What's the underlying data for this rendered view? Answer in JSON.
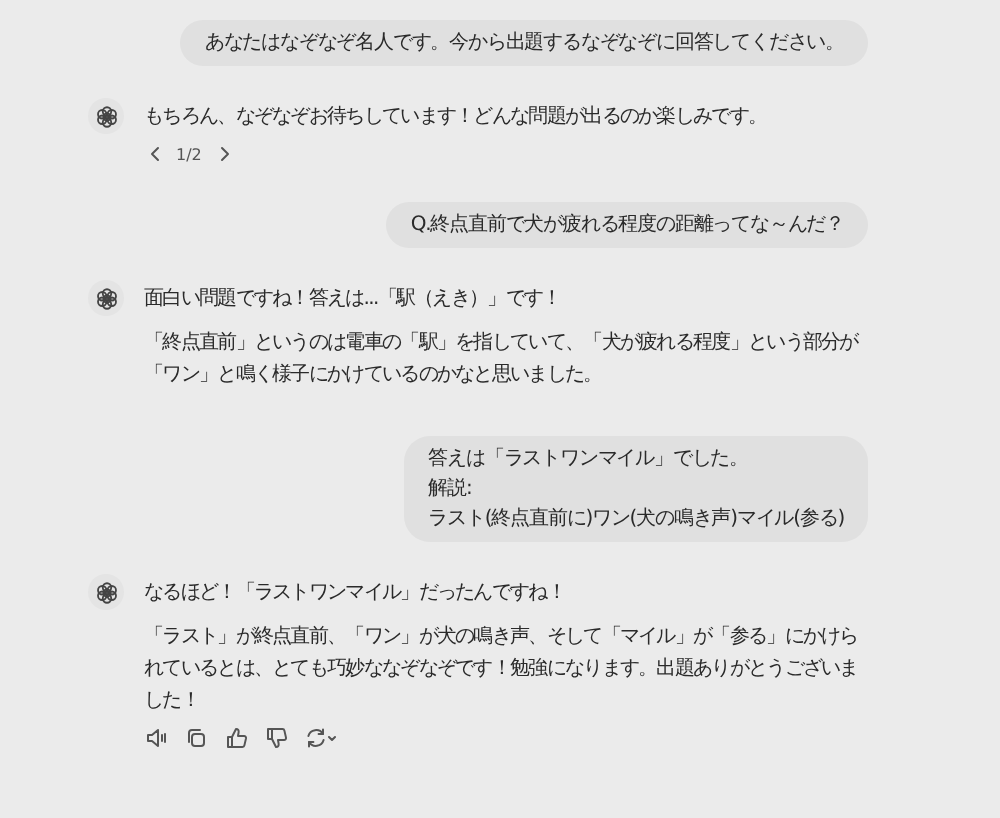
{
  "messages": [
    {
      "kind": "user",
      "lines": [
        "あなたはなぞなぞ名人です。今から出題するなぞなぞに回答してください。"
      ]
    },
    {
      "kind": "assistant",
      "paragraphs": [
        "もちろん、なぞなぞお待ちしています！どんな問題が出るのか楽しみです。"
      ],
      "pager": "1/2"
    },
    {
      "kind": "user",
      "lines": [
        "Q.終点直前で犬が疲れる程度の距離ってな～んだ？"
      ]
    },
    {
      "kind": "assistant",
      "paragraphs": [
        "面白い問題ですね！答えは...「駅（えき）」です！",
        "「終点直前」というのは電車の「駅」を指していて、「犬が疲れる程度」という部分が「ワン」と鳴く様子にかけているのかなと思いました。"
      ]
    },
    {
      "kind": "user",
      "lines": [
        "答えは「ラストワンマイル」でした。",
        "解説:",
        "ラスト(終点直前に)ワン(犬の鳴き声)マイル(参る)"
      ]
    },
    {
      "kind": "assistant",
      "paragraphs": [
        "なるほど！「ラストワンマイル」だったんですね！",
        "「ラスト」が終点直前、「ワン」が犬の鳴き声、そして「マイル」が「参る」にかけられているとは、とても巧妙ななぞなぞです！勉強になります。出題ありがとうございました！"
      ],
      "actions": true
    }
  ]
}
